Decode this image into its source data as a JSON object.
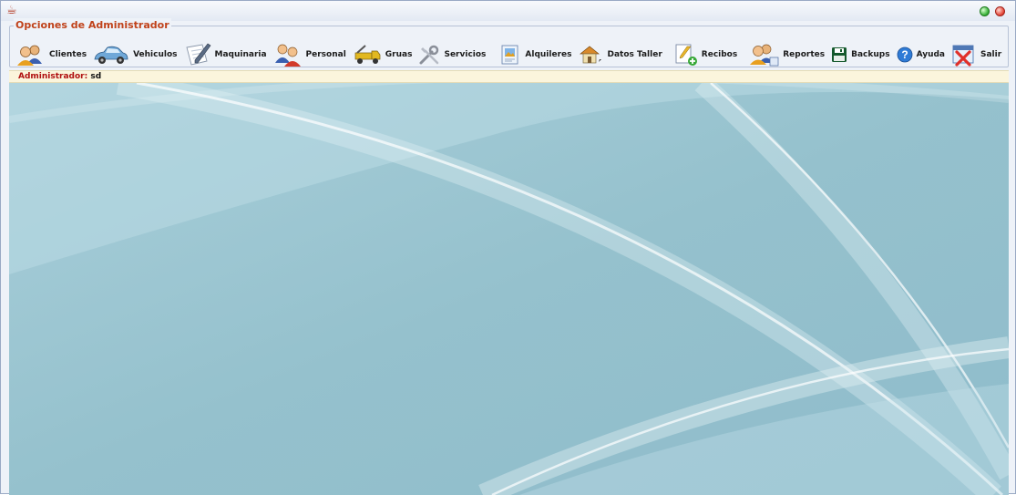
{
  "window": {
    "app_icon": "coffee-cup-icon",
    "controls": {
      "minimize_color": "#3ab33a",
      "close_color": "#e6483a"
    }
  },
  "options_group": {
    "legend": "Opciones de Administrador"
  },
  "toolbar": {
    "items": [
      {
        "id": "clientes",
        "label": "Clientes",
        "icon": "users-icon"
      },
      {
        "id": "vehiculos",
        "label": "Vehiculos",
        "icon": "car-icon"
      },
      {
        "id": "maquinaria",
        "label": "Maquinaria",
        "icon": "notepad-pencil-icon"
      },
      {
        "id": "personal",
        "label": "Personal",
        "icon": "staff-icon"
      },
      {
        "id": "gruas",
        "label": "Gruas",
        "icon": "tow-truck-icon"
      },
      {
        "id": "servicios",
        "label": "Servicios",
        "icon": "tools-icon"
      },
      {
        "id": "alquileres",
        "label": "Alquileres",
        "icon": "document-image-icon"
      },
      {
        "id": "datos-taller",
        "label": "Datos Taller",
        "icon": "house-icon"
      },
      {
        "id": "recibos",
        "label": "Recibos",
        "icon": "receipt-icon"
      },
      {
        "id": "reportes",
        "label": "Reportes",
        "icon": "users-report-icon"
      },
      {
        "id": "backups",
        "label": "Backups",
        "icon": "floppy-disk-icon"
      },
      {
        "id": "ayuda",
        "label": "Ayuda",
        "icon": "help-icon"
      },
      {
        "id": "salir",
        "label": "Salir",
        "icon": "exit-icon"
      }
    ]
  },
  "status": {
    "role_label": "Administrador:",
    "user": "sd"
  },
  "colors": {
    "legend_text": "#c0421a",
    "status_label": "#b01010",
    "status_background": "#fbf5dc",
    "desktop_background": "#9cc6d2"
  }
}
